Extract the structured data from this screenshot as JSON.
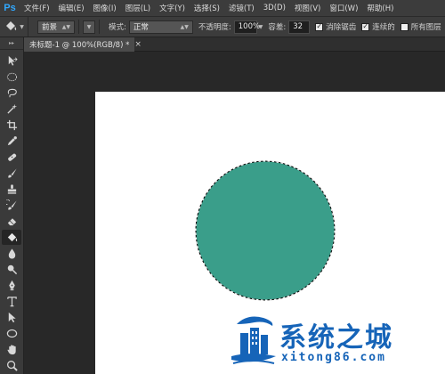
{
  "app": {
    "logo": "Ps"
  },
  "menu": [
    "文件(F)",
    "编辑(E)",
    "图像(I)",
    "图层(L)",
    "文字(Y)",
    "选择(S)",
    "滤镜(T)",
    "3D(D)",
    "视图(V)",
    "窗口(W)",
    "帮助(H)"
  ],
  "options": {
    "fill_source": "前景",
    "mode_label": "模式:",
    "mode_value": "正常",
    "opacity_label": "不透明度:",
    "opacity_value": "100%",
    "tolerance_label": "容差:",
    "tolerance_value": "32",
    "antialias_label": "消除锯齿",
    "antialias_checked": true,
    "contiguous_label": "连续的",
    "contiguous_checked": true,
    "all_layers_label": "所有图层",
    "all_layers_checked": false
  },
  "document": {
    "tab_title": "未标题-1 @ 100%(RGB/8) *",
    "fill_color": "#3a9e8a",
    "canvas_color": "#ffffff"
  },
  "tools": [
    "move-tool-icon",
    "marquee-ellipse-tool-icon",
    "lasso-tool-icon",
    "magic-wand-tool-icon",
    "crop-tool-icon",
    "eyedropper-tool-icon",
    "healing-brush-tool-icon",
    "brush-tool-icon",
    "clone-stamp-tool-icon",
    "history-brush-tool-icon",
    "eraser-tool-icon",
    "paint-bucket-tool-icon",
    "blur-tool-icon",
    "dodge-tool-icon",
    "pen-tool-icon",
    "type-tool-icon",
    "path-selection-tool-icon",
    "ellipse-shape-tool-icon",
    "hand-tool-icon",
    "zoom-tool-icon"
  ],
  "active_tool": "paint-bucket-tool-icon",
  "watermark": {
    "title": "系统之城",
    "subtitle": "xitong86.com",
    "color": "#1664b8"
  }
}
